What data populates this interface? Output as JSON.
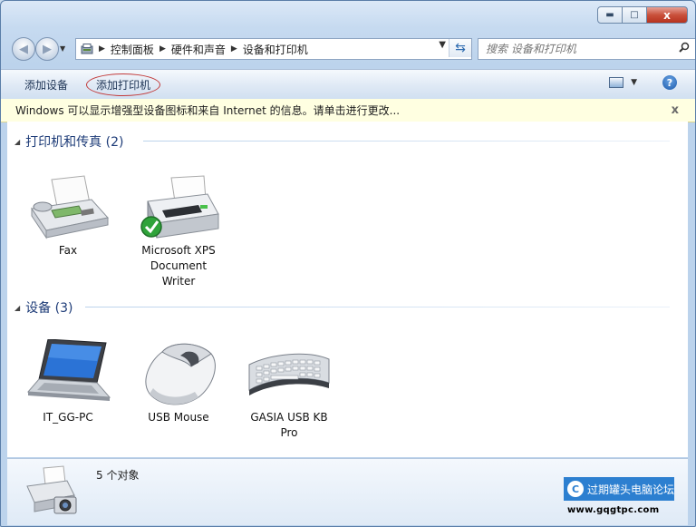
{
  "window": {
    "minimize_label": "▬",
    "maximize_label": "□",
    "close_label": "x"
  },
  "address_bar": {
    "breadcrumbs": [
      "控制面板",
      "硬件和声音",
      "设备和打印机"
    ]
  },
  "search": {
    "placeholder": "搜索 设备和打印机"
  },
  "toolbar": {
    "add_device": "添加设备",
    "add_printer": "添加打印机",
    "help_label": "?"
  },
  "infobar": {
    "text": "Windows 可以显示增强型设备图标和来自 Internet 的信息。请单击进行更改...",
    "close_label": "x"
  },
  "groups": {
    "printers": {
      "header": "打印机和传真 (2)",
      "items": [
        {
          "label": "Fax"
        },
        {
          "label": "Microsoft XPS Document Writer"
        }
      ]
    },
    "devices": {
      "header": "设备 (3)",
      "items": [
        {
          "label": "IT_GG-PC"
        },
        {
          "label": "USB Mouse"
        },
        {
          "label": "GASIA USB KB Pro"
        }
      ]
    }
  },
  "details": {
    "count": "5 个对象"
  },
  "watermark": {
    "title": "过期罐头电脑论坛",
    "url": "www.gqgtpc.com"
  },
  "colors": {
    "accent": "#1e3c78",
    "infobar_bg": "#ffffe1",
    "close_red": "#c9503b",
    "watermark_blue": "#2c7fd0"
  }
}
